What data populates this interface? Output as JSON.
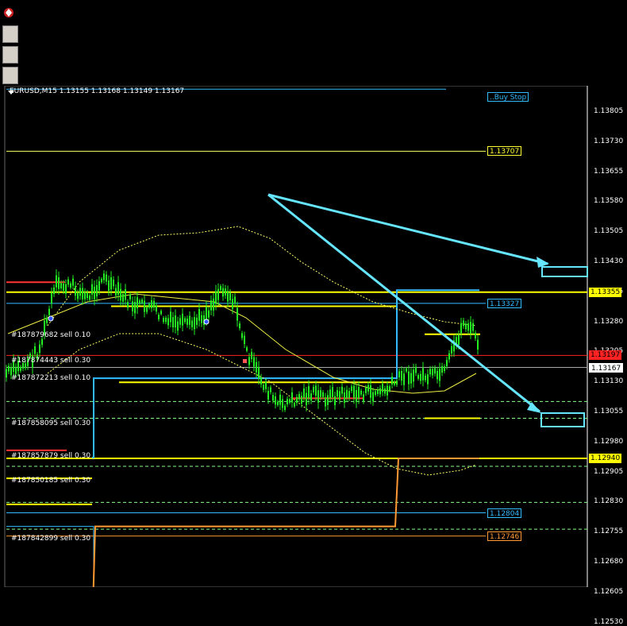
{
  "chart_header": "EURUSD,M15  1.13155 1.13168 1.13149 1.13167",
  "top_label": "..Buy Stop",
  "axis_ticks": [
    "1.13805",
    "1.13730",
    "1.13655",
    "1.13580",
    "1.13505",
    "1.13430",
    "1.13355",
    "1.13280",
    "1.13205",
    "1.13130",
    "1.13055",
    "1.12980",
    "1.12905",
    "1.12830",
    "1.12755",
    "1.12680",
    "1.12605",
    "1.12530"
  ],
  "price_labels": [
    {
      "text": "1.13707",
      "color": "#ffff33"
    },
    {
      "text": "1.13327",
      "color": "#33bbff"
    },
    {
      "text": "1.13355",
      "color": "#ffff00"
    },
    {
      "text": "1.13197",
      "color": "#ff2222"
    },
    {
      "text": "1.13167",
      "color": "#ffffff"
    },
    {
      "text": "1.12940",
      "color": "#ffff00"
    },
    {
      "text": "1.12804",
      "color": "#33bbff"
    },
    {
      "text": "1.12746",
      "color": "#ff9933"
    }
  ],
  "order_labels": [
    "#187879682  sell 0.10",
    "#187874443  sell 0.30",
    "#187872213  sell 0.10",
    "#187858095  sell 0.30",
    "#187857879  sell 0.30",
    "#187850185  sell 0.30",
    "#187842899  sell 0.30"
  ],
  "colors": {
    "background": "#000000",
    "candle": "#22ee22",
    "support": "#ffff00",
    "resistance": "#33bbff",
    "sl": "#ff2222",
    "arrow": "#66e5ff"
  }
}
